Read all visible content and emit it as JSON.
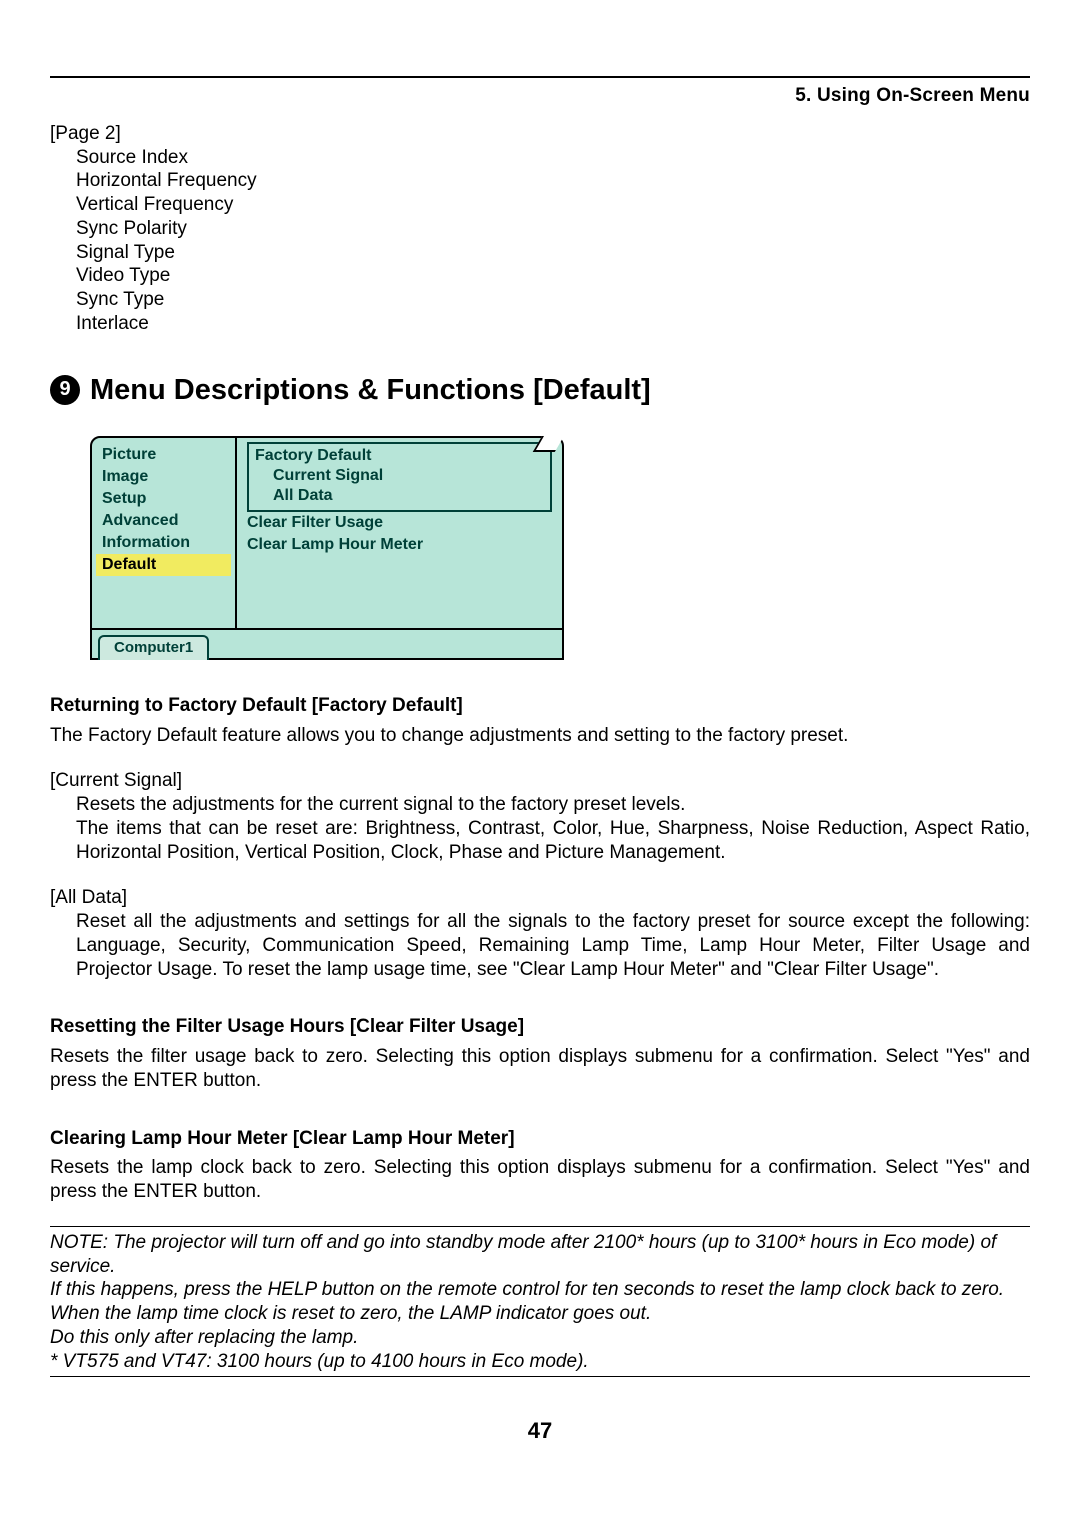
{
  "chapter": "5. Using On-Screen Menu",
  "page2": {
    "header": "[Page 2]",
    "items": [
      "Source Index",
      "Horizontal Frequency",
      "Vertical Frequency",
      "Sync Polarity",
      "Signal Type",
      "Video Type",
      "Sync Type",
      "Interlace"
    ]
  },
  "section": {
    "number": "9",
    "title": "Menu Descriptions & Functions [Default]"
  },
  "osd": {
    "nav": [
      {
        "label": "Picture"
      },
      {
        "label": "Image"
      },
      {
        "label": "Setup"
      },
      {
        "label": "Advanced"
      },
      {
        "label": "Information"
      },
      {
        "label": "Default",
        "selected": true
      }
    ],
    "panel": {
      "group_head": "Factory Default",
      "group_subs": [
        "Current Signal",
        "All Data"
      ],
      "lines": [
        "Clear Filter Usage",
        "Clear Lamp Hour Meter"
      ]
    },
    "tab": "Computer1"
  },
  "h3_a": "Returning to Factory Default [Factory Default]",
  "p_a": "The Factory Default feature allows you to change adjustments and setting to the factory preset.",
  "term1": "[Current Signal]",
  "def1a": "Resets the adjustments for the current signal to the factory preset levels.",
  "def1b": "The items that can be reset are: Brightness, Contrast, Color, Hue, Sharpness, Noise Reduction, Aspect Ratio, Horizontal Position, Vertical Position, Clock, Phase and Picture Management.",
  "term2": "[All Data]",
  "def2": "Reset all the adjustments and settings for all the signals to the factory preset for source except the following: Language, Security, Communication Speed, Remaining Lamp Time, Lamp Hour Meter, Filter Usage and Projector Usage. To reset the lamp usage time, see \"Clear Lamp Hour Meter\" and \"Clear Filter Usage\".",
  "h3_b": "Resetting the Filter Usage Hours [Clear Filter Usage]",
  "p_b": "Resets the filter usage back to zero. Selecting this option displays submenu for a confirmation. Select \"Yes\" and press the ENTER button.",
  "h3_c": "Clearing Lamp Hour Meter [Clear Lamp Hour Meter]",
  "p_c": "Resets the lamp clock back to zero. Selecting this option displays submenu for a confirmation. Select \"Yes\" and press the ENTER button.",
  "note": {
    "l1": "NOTE: The projector will turn off and go into standby mode after 2100* hours (up to 3100* hours in Eco mode) of service.",
    "l2": "If this happens, press the HELP button on the remote control for ten seconds to reset the lamp clock back to zero.",
    "l3": "When the lamp time clock is reset to zero, the LAMP indicator goes out.",
    "l4": "Do this only after replacing the lamp.",
    "l5": "* VT575 and VT47: 3100 hours (up to 4100 hours in Eco mode)."
  },
  "page_number": "47"
}
